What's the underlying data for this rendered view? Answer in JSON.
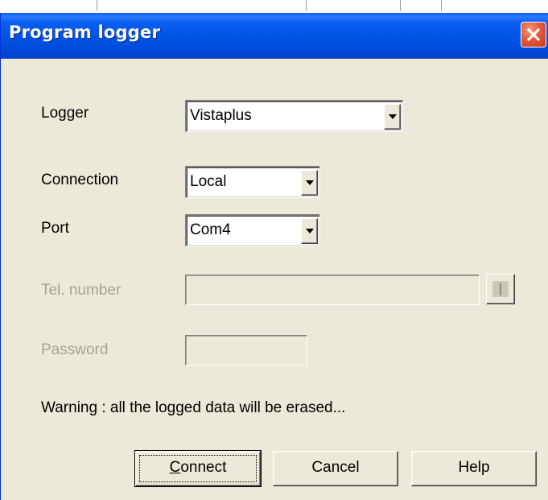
{
  "dialog": {
    "title": "Program logger"
  },
  "fields": {
    "logger": {
      "label": "Logger",
      "value": "Vistaplus"
    },
    "connection": {
      "label": "Connection",
      "value": "Local"
    },
    "port": {
      "label": "Port",
      "value": "Com4"
    },
    "tel_number": {
      "label": "Tel. number",
      "value": ""
    },
    "password": {
      "label": "Password",
      "value": ""
    }
  },
  "warning": "Warning : all the logged data will be erased...",
  "buttons": {
    "connect_mnemonic": "C",
    "connect_rest": "onnect",
    "cancel": "Cancel",
    "help": "Help"
  },
  "colors": {
    "titlebar": "#0054e3",
    "dialog_bg": "#ece9d8",
    "close_button": "#e2593d",
    "disabled_text": "#a6a39a"
  },
  "icons": {
    "close": "close-icon",
    "phonebook": "phonebook-icon",
    "dropdown": "chevron-down-icon"
  }
}
